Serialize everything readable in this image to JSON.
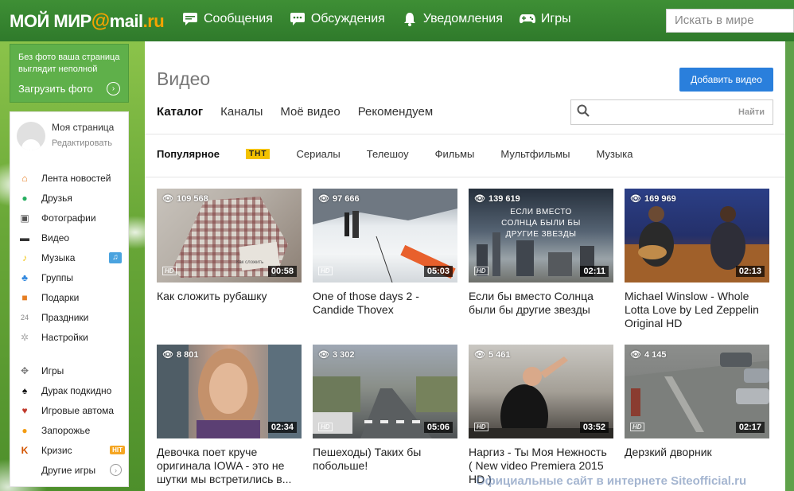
{
  "header": {
    "logo": {
      "part1": "МОЙ МИР",
      "at": "@",
      "part2": "mail",
      "part3": ".ru"
    },
    "nav": [
      {
        "label": "Сообщения",
        "icon": "chat-icon"
      },
      {
        "label": "Обсуждения",
        "icon": "discussion-icon"
      },
      {
        "label": "Уведомления",
        "icon": "bell-icon"
      },
      {
        "label": "Игры",
        "icon": "gamepad-icon"
      }
    ],
    "search_placeholder": "Искать в мире"
  },
  "upload": {
    "text": "Без фото ваша страница выглядит неполной",
    "link": "Загрузить фото"
  },
  "profile": {
    "name": "Моя страница",
    "edit": "Редактировать"
  },
  "sidebar": {
    "items": [
      {
        "label": "Лента новостей",
        "icon": "home-icon"
      },
      {
        "label": "Друзья",
        "icon": "friends-icon"
      },
      {
        "label": "Фотографии",
        "icon": "camera-icon"
      },
      {
        "label": "Видео",
        "icon": "video-icon"
      },
      {
        "label": "Музыка",
        "icon": "music-icon"
      },
      {
        "label": "Группы",
        "icon": "groups-icon"
      },
      {
        "label": "Подарки",
        "icon": "gift-icon"
      },
      {
        "label": "Праздники",
        "icon": "calendar-icon"
      },
      {
        "label": "Настройки",
        "icon": "gear-icon"
      }
    ],
    "games": [
      {
        "label": "Игры",
        "icon": "games-icon"
      },
      {
        "label": "Дурак подкидно",
        "icon": "cards-icon"
      },
      {
        "label": "Игровые автома",
        "icon": "heart-icon"
      },
      {
        "label": "Запорожье",
        "icon": "coin-icon"
      },
      {
        "label": "Кризис",
        "icon": "k-icon",
        "badge": "HIT"
      },
      {
        "label": "Другие игры",
        "icon": ""
      }
    ]
  },
  "main": {
    "title": "Видео",
    "add_button": "Добавить видео",
    "tabs": [
      "Каталог",
      "Каналы",
      "Моё видео",
      "Рекомендуем"
    ],
    "search_button": "Найти",
    "categories": [
      "Популярное",
      "ТНТ",
      "Сериалы",
      "Телешоу",
      "Фильмы",
      "Мультфильмы",
      "Музыка"
    ],
    "videos": [
      {
        "views": "109 568",
        "duration": "00:58",
        "title": "Как сложить рубашку",
        "overlay": "Как сложить"
      },
      {
        "views": "97 666",
        "duration": "05:03",
        "title": "One of those days 2 - Candide Thovex",
        "overlay": ""
      },
      {
        "views": "139 619",
        "duration": "02:11",
        "title": "Если бы вместо Солнца были бы другие звезды",
        "overlay": "ЕСЛИ ВМЕСТО СОЛНЦА БЫЛИ БЫ ДРУГИЕ ЗВЕЗДЫ"
      },
      {
        "views": "169 969",
        "duration": "02:13",
        "title": "Michael Winslow - Whole Lotta Love by Led Zeppelin Original HD",
        "overlay": ""
      },
      {
        "views": "8 801",
        "duration": "02:34",
        "title": "Девочка поет круче оригинала IOWA - это не шутки мы встретились в...",
        "overlay": ""
      },
      {
        "views": "3 302",
        "duration": "05:06",
        "title": "Пешеходы) Таких бы побольше!",
        "overlay": ""
      },
      {
        "views": "5 461",
        "duration": "03:52",
        "title": "Наргиз - Ты Моя Нежность ( New video Premiera 2015 HD )",
        "overlay": ""
      },
      {
        "views": "4 145",
        "duration": "02:17",
        "title": "Дерзкий дворник",
        "overlay": ""
      }
    ],
    "hd_label": "HD"
  },
  "watermark": "Официальные сайт в интернете Siteofficial.ru",
  "colors": {
    "topbar": "#2f7a2b",
    "accent_blue": "#2a7fdc",
    "upload_green": "#5fb04a"
  }
}
